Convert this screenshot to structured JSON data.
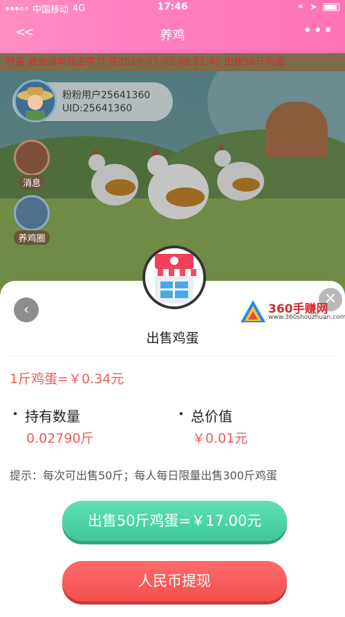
{
  "status_bar": {
    "carrier": "中国移动",
    "network": "4G",
    "time": "17:46"
  },
  "nav": {
    "back_label": "<<",
    "title": "养鸡",
    "more_label": "•••"
  },
  "scene": {
    "marquee": "恭喜 看到请叫我去学习 在2019-03-02 08:51:40 出售50斤鸡蛋",
    "user": {
      "name": "粉粉用户25641360",
      "uid": "UID:25641360"
    },
    "side_buttons": [
      {
        "label": "消息"
      },
      {
        "label": "养鸡圈"
      }
    ]
  },
  "sheet": {
    "back_label": "‹",
    "close_label": "×",
    "watermark": {
      "brand": "360手赚网",
      "url": "www.360shouzhuan.com"
    },
    "title": "出售鸡蛋",
    "price": "1斤鸡蛋=￥0.34元",
    "holdings_label": "持有数量",
    "holdings_value": "0.02790斤",
    "total_label": "总价值",
    "total_value": "￥0.01元",
    "hint": "提示：每次可出售50斤；每人每日限量出售300斤鸡蛋",
    "sell_button": "出售50斤鸡蛋=￥17.00元",
    "cash_button": "人民币提现"
  },
  "colors": {
    "nav_pink": "#ff7fbf",
    "sell_green": "#3fc79b",
    "cash_red": "#f24f4f",
    "price_red": "#ee5a5a"
  }
}
